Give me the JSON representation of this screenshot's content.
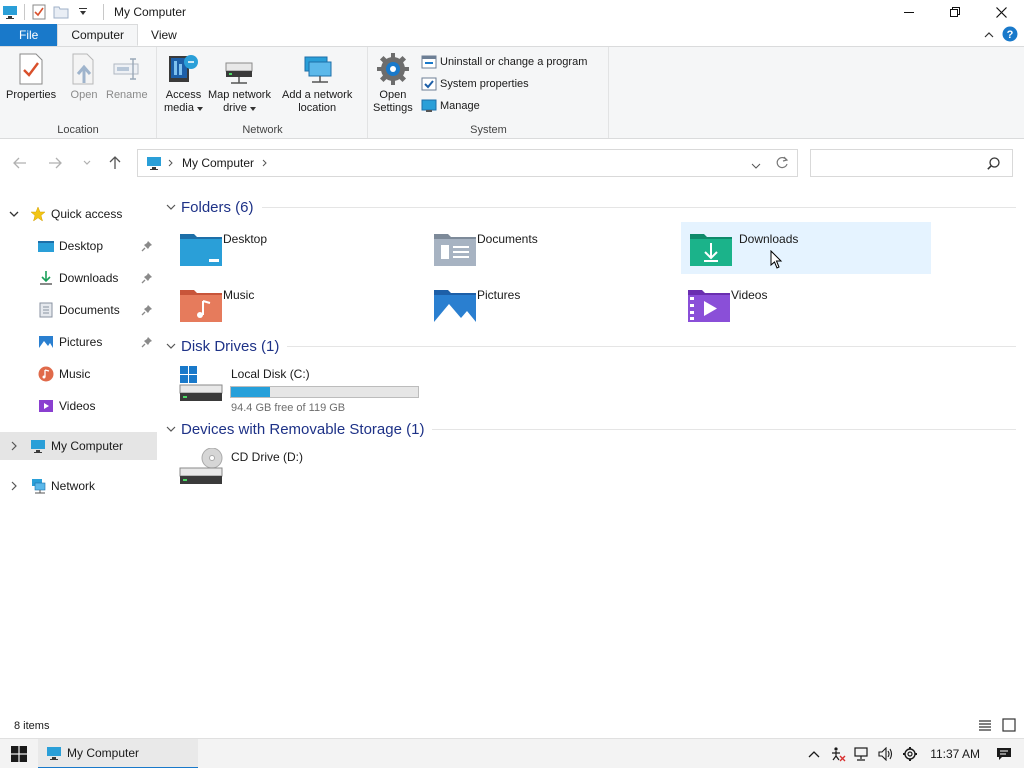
{
  "window": {
    "title": "My Computer"
  },
  "ribbon": {
    "tabs": [
      {
        "label": "File"
      },
      {
        "label": "Computer"
      },
      {
        "label": "View"
      }
    ],
    "location": {
      "label": "Location",
      "properties": "Properties",
      "open": "Open",
      "rename": "Rename"
    },
    "network": {
      "label": "Network",
      "access_media_1": "Access",
      "access_media_2": "media",
      "map_drive_1": "Map network",
      "map_drive_2": "drive",
      "add_location_1": "Add a network",
      "add_location_2": "location"
    },
    "system": {
      "label": "System",
      "open_settings_1": "Open",
      "open_settings_2": "Settings",
      "uninstall": "Uninstall or change a program",
      "system_properties": "System properties",
      "manage": "Manage"
    }
  },
  "address": {
    "path": "My Computer",
    "search_placeholder": ""
  },
  "sidebar": {
    "quick_access": "Quick access",
    "items": [
      {
        "label": "Desktop",
        "pinned": true
      },
      {
        "label": "Downloads",
        "pinned": true
      },
      {
        "label": "Documents",
        "pinned": true
      },
      {
        "label": "Pictures",
        "pinned": true
      },
      {
        "label": "Music",
        "pinned": false
      },
      {
        "label": "Videos",
        "pinned": false
      }
    ],
    "my_computer": "My Computer",
    "network": "Network"
  },
  "content": {
    "folders_header": "Folders (6)",
    "folders": [
      {
        "name": "Desktop"
      },
      {
        "name": "Documents"
      },
      {
        "name": "Downloads"
      },
      {
        "name": "Music"
      },
      {
        "name": "Pictures"
      },
      {
        "name": "Videos"
      }
    ],
    "drives_header": "Disk Drives (1)",
    "drives": [
      {
        "name": "Local Disk (C:)",
        "free_text": "94.4 GB free of 119 GB",
        "used_fraction": 0.207
      }
    ],
    "removable_header": "Devices with Removable Storage (1)",
    "removable": [
      {
        "name": "CD Drive (D:)"
      }
    ]
  },
  "status": {
    "items_count": "8 items"
  },
  "taskbar": {
    "app_label": "My Computer",
    "clock": "11:37 AM"
  },
  "colors": {
    "accent": "#1979ca",
    "group_header": "#1e3287",
    "drive_bar": "#26a0da",
    "hover": "#e5f3ff"
  }
}
